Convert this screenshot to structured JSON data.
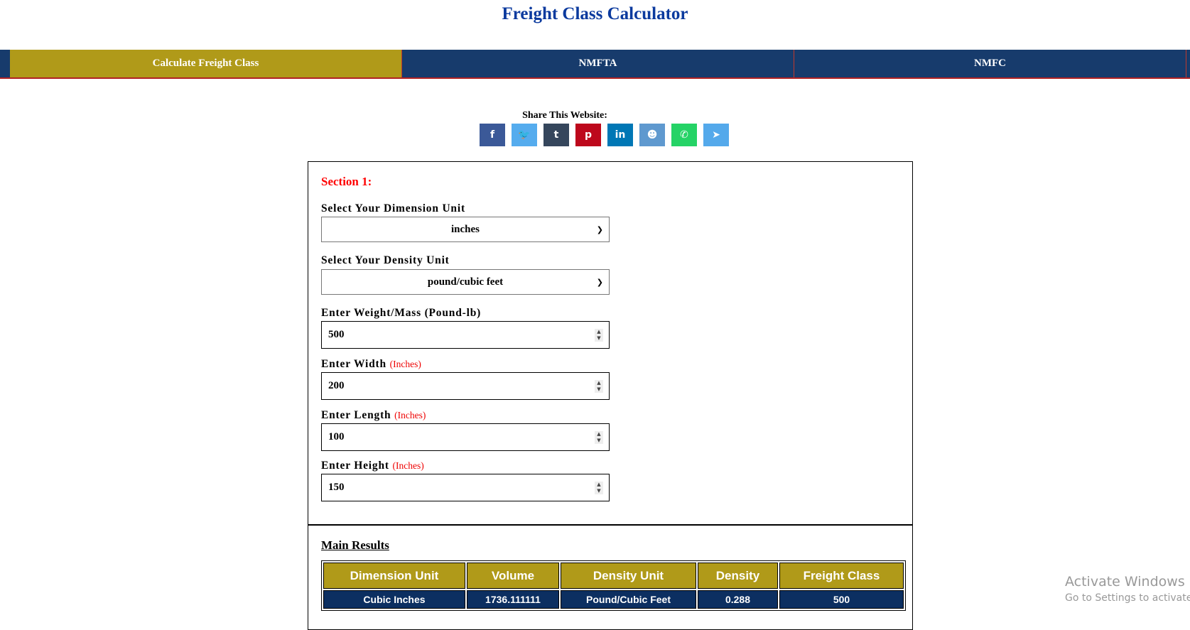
{
  "header": {
    "title": "Freight Class Calculator"
  },
  "nav": {
    "tabs": [
      {
        "label": "Calculate Freight Class",
        "active": true
      },
      {
        "label": "NMFTA"
      },
      {
        "label": "NMFC"
      }
    ]
  },
  "share": {
    "label": "Share This Website:",
    "buttons": [
      {
        "icon": "facebook-icon",
        "glyph": "f",
        "color": "#3b5998"
      },
      {
        "icon": "twitter-icon",
        "glyph": "🐦",
        "color": "#55acee"
      },
      {
        "icon": "tumblr-icon",
        "glyph": "t",
        "color": "#35465c"
      },
      {
        "icon": "pinterest-icon",
        "glyph": "p",
        "color": "#bd081c"
      },
      {
        "icon": "linkedin-icon",
        "glyph": "in",
        "color": "#0077b5"
      },
      {
        "icon": "reddit-icon",
        "glyph": "☻",
        "color": "#5f99cf"
      },
      {
        "icon": "whatsapp-icon",
        "glyph": "✆",
        "color": "#25d366"
      },
      {
        "icon": "telegram-icon",
        "glyph": "➤",
        "color": "#54a9eb"
      }
    ]
  },
  "form": {
    "section_label": "Section 1:",
    "dimension_unit": {
      "label": "Select Your Dimension Unit",
      "value": "inches"
    },
    "density_unit": {
      "label": "Select Your Density Unit",
      "value": "pound/cubic feet"
    },
    "weight": {
      "label": "Enter Weight/Mass (Pound-lb)",
      "value": "500"
    },
    "width": {
      "label": "Enter Width",
      "unit": "(Inches)",
      "value": "200"
    },
    "length": {
      "label": "Enter Length",
      "unit": "(Inches)",
      "value": "100"
    },
    "height": {
      "label": "Enter Height",
      "unit": "(Inches)",
      "value": "150"
    }
  },
  "results": {
    "title": "Main Results",
    "headers": [
      "Dimension Unit",
      "Volume",
      "Density Unit",
      "Density",
      "Freight Class"
    ],
    "row": [
      "Cubic Inches",
      "1736.111111",
      "Pound/Cubic Feet",
      "0.288",
      "500"
    ]
  },
  "watermark": {
    "line1": "Activate Windows",
    "line2": "Go to Settings to activate Windows."
  },
  "colors": {
    "title": "#0b3a9e",
    "nav": "#173b6c",
    "active_tab": "#b09a19",
    "header_cell": "#b09a19",
    "body_cell": "#0c2f61",
    "accent_red": "#ff0000"
  }
}
